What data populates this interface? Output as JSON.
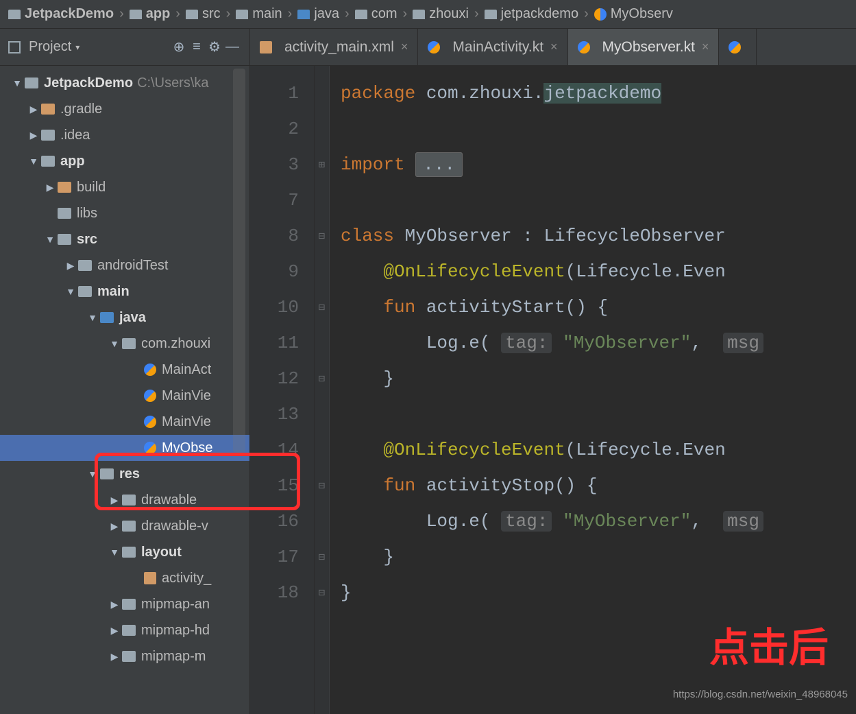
{
  "breadcrumb": [
    {
      "label": "JetpackDemo",
      "icon": "folder-gray"
    },
    {
      "label": "app",
      "icon": "folder-gray"
    },
    {
      "label": "src",
      "icon": "folder-gray"
    },
    {
      "label": "main",
      "icon": "folder-gray"
    },
    {
      "label": "java",
      "icon": "folder-blue"
    },
    {
      "label": "com",
      "icon": "folder-gray"
    },
    {
      "label": "zhouxi",
      "icon": "folder-gray"
    },
    {
      "label": "jetpackdemo",
      "icon": "folder-gray"
    },
    {
      "label": "MyObserv",
      "icon": "kt"
    }
  ],
  "sidebar": {
    "title": "Project",
    "icons": {
      "target": "⊕",
      "filter": "≡",
      "settings": "⚙",
      "minimize": "—"
    },
    "tree": [
      {
        "label": "JetpackDemo",
        "hint": "C:\\Users\\ka",
        "indent": 0,
        "arrow": "down",
        "icon": "folder-gray",
        "bold": true
      },
      {
        "label": ".gradle",
        "indent": 1,
        "arrow": "right",
        "icon": "folder-orange"
      },
      {
        "label": ".idea",
        "indent": 1,
        "arrow": "right",
        "icon": "folder-gray"
      },
      {
        "label": "app",
        "indent": 1,
        "arrow": "down",
        "icon": "folder-gray",
        "bold": true
      },
      {
        "label": "build",
        "indent": 2,
        "arrow": "right",
        "icon": "folder-orange"
      },
      {
        "label": "libs",
        "indent": 2,
        "arrow": "none",
        "icon": "folder-gray"
      },
      {
        "label": "src",
        "indent": 2,
        "arrow": "down",
        "icon": "folder-gray",
        "bold": true
      },
      {
        "label": "androidTest",
        "indent": 3,
        "arrow": "right",
        "icon": "folder-gray"
      },
      {
        "label": "main",
        "indent": 3,
        "arrow": "down",
        "icon": "folder-gray",
        "bold": true
      },
      {
        "label": "java",
        "indent": 4,
        "arrow": "down",
        "icon": "folder-blue",
        "bold": true
      },
      {
        "label": "com.zhouxi",
        "indent": 5,
        "arrow": "down",
        "icon": "folder-pkg"
      },
      {
        "label": "MainAct",
        "indent": 6,
        "arrow": "none",
        "icon": "kt"
      },
      {
        "label": "MainVie",
        "indent": 6,
        "arrow": "none",
        "icon": "kt"
      },
      {
        "label": "MainVie",
        "indent": 6,
        "arrow": "none",
        "icon": "kt"
      },
      {
        "label": "MyObse",
        "indent": 6,
        "arrow": "none",
        "icon": "kt",
        "selected": true
      },
      {
        "label": "res",
        "indent": 4,
        "arrow": "down",
        "icon": "folder-res",
        "bold": true
      },
      {
        "label": "drawable",
        "indent": 5,
        "arrow": "right",
        "icon": "folder-gray"
      },
      {
        "label": "drawable-v",
        "indent": 5,
        "arrow": "right",
        "icon": "folder-gray"
      },
      {
        "label": "layout",
        "indent": 5,
        "arrow": "down",
        "icon": "folder-gray",
        "bold": true
      },
      {
        "label": "activity_",
        "indent": 6,
        "arrow": "none",
        "icon": "xml"
      },
      {
        "label": "mipmap-an",
        "indent": 5,
        "arrow": "right",
        "icon": "folder-gray"
      },
      {
        "label": "mipmap-hd",
        "indent": 5,
        "arrow": "right",
        "icon": "folder-gray"
      },
      {
        "label": "mipmap-m",
        "indent": 5,
        "arrow": "right",
        "icon": "folder-gray"
      }
    ]
  },
  "tabs": [
    {
      "label": "activity_main.xml",
      "icon": "xml",
      "active": false
    },
    {
      "label": "MainActivity.kt",
      "icon": "kt",
      "active": false
    },
    {
      "label": "MyObserver.kt",
      "icon": "kt",
      "active": true
    },
    {
      "label": "",
      "icon": "kt",
      "active": false
    }
  ],
  "gutter": [
    "1",
    "2",
    "3",
    "7",
    "8",
    "9",
    "10",
    "11",
    "12",
    "13",
    "14",
    "15",
    "16",
    "17",
    "18"
  ],
  "fold": [
    "",
    "",
    "⊞",
    "",
    "⊟",
    "",
    "⊟",
    "",
    "⊟",
    "",
    "",
    "⊟",
    "",
    "⊟",
    "⊟"
  ],
  "code": {
    "l1_kw": "package",
    "l1_pkg": "com.zhouxi.",
    "l1_hl": "jetpackdemo",
    "l3_kw": "import",
    "l3_dots": "...",
    "l5_kw": "class",
    "l5_name": "MyObserver : LifecycleObserver",
    "l6_ann": "@OnLifecycleEvent",
    "l6_rest": "(Lifecycle.Even",
    "l7_kw": "fun",
    "l7_name": "activityStart() {",
    "l8a": "Log.e(",
    "l8_hint": "tag:",
    "l8_str": "\"MyObserver\"",
    "l8_c": ",",
    "l8_hint2": "msg",
    "l9": "}",
    "l11_ann": "@OnLifecycleEvent",
    "l11_rest": "(Lifecycle.Even",
    "l12_kw": "fun",
    "l12_name": "activityStop() {",
    "l13a": "Log.e(",
    "l13_hint": "tag:",
    "l13_str": "\"MyObserver\"",
    "l13_c": ",",
    "l13_hint2": "msg",
    "l14": "}",
    "l15": "}"
  },
  "annotation": {
    "big_red": "点击后",
    "watermark": "https://blog.csdn.net/weixin_48968045"
  }
}
